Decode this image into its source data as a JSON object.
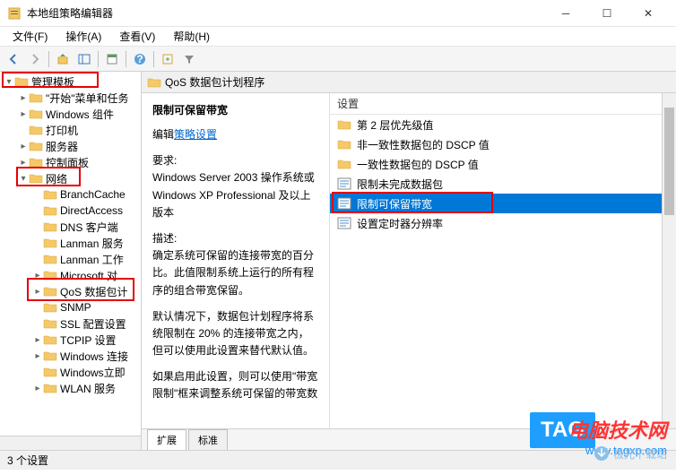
{
  "window": {
    "title": "本地组策略编辑器"
  },
  "menu": {
    "file": "文件(F)",
    "action": "操作(A)",
    "view": "查看(V)",
    "help": "帮助(H)"
  },
  "tree": {
    "items": [
      {
        "label": "管理模板",
        "indent": 0,
        "arrow": "▾"
      },
      {
        "label": "\"开始\"菜单和任务",
        "indent": 1,
        "arrow": "▸"
      },
      {
        "label": "Windows 组件",
        "indent": 1,
        "arrow": "▸"
      },
      {
        "label": "打印机",
        "indent": 1,
        "arrow": ""
      },
      {
        "label": "服务器",
        "indent": 1,
        "arrow": "▸"
      },
      {
        "label": "控制面板",
        "indent": 1,
        "arrow": "▸"
      },
      {
        "label": "网络",
        "indent": 1,
        "arrow": "▾"
      },
      {
        "label": "BranchCache",
        "indent": 2,
        "arrow": ""
      },
      {
        "label": "DirectAccess",
        "indent": 2,
        "arrow": ""
      },
      {
        "label": "DNS 客户端",
        "indent": 2,
        "arrow": ""
      },
      {
        "label": "Lanman 服务",
        "indent": 2,
        "arrow": ""
      },
      {
        "label": "Lanman 工作",
        "indent": 2,
        "arrow": ""
      },
      {
        "label": "Microsoft 对",
        "indent": 2,
        "arrow": "▸"
      },
      {
        "label": "QoS 数据包计",
        "indent": 2,
        "arrow": "▸"
      },
      {
        "label": "SNMP",
        "indent": 2,
        "arrow": ""
      },
      {
        "label": "SSL 配置设置",
        "indent": 2,
        "arrow": ""
      },
      {
        "label": "TCPIP 设置",
        "indent": 2,
        "arrow": "▸"
      },
      {
        "label": "Windows 连接",
        "indent": 2,
        "arrow": "▸"
      },
      {
        "label": "Windows立即",
        "indent": 2,
        "arrow": ""
      },
      {
        "label": "WLAN 服务",
        "indent": 2,
        "arrow": "▸"
      }
    ]
  },
  "content": {
    "header": "QoS 数据包计划程序",
    "title": "限制可保留带宽",
    "edit_prefix": "编辑",
    "edit_link": "策略设置",
    "req_label": "要求:",
    "req_text": "Windows Server 2003 操作系统或 Windows XP Professional 及以上版本",
    "desc_label": "描述:",
    "desc_text1": "确定系统可保留的连接带宽的百分比。此值限制系统上运行的所有程序的组合带宽保留。",
    "desc_text2": "默认情况下，数据包计划程序将系统限制在 20% 的连接带宽之内，但可以使用此设置来替代默认值。",
    "desc_text3": "如果启用此设置，则可以使用\"带宽限制\"框来调整系统可保留的带宽数"
  },
  "right": {
    "header": "设置",
    "items": [
      {
        "label": "第 2 层优先级值",
        "type": "folder"
      },
      {
        "label": "非一致性数据包的 DSCP 值",
        "type": "folder"
      },
      {
        "label": "一致性数据包的 DSCP 值",
        "type": "folder"
      },
      {
        "label": "限制未完成数据包",
        "type": "setting"
      },
      {
        "label": "限制可保留带宽",
        "type": "setting",
        "selected": true
      },
      {
        "label": "设置定时器分辨率",
        "type": "setting"
      }
    ]
  },
  "tabs": {
    "extended": "扩展",
    "standard": "标准"
  },
  "status": "3 个设置",
  "watermark": {
    "line1": "电脑技术网",
    "line2": "www.tagxp.com",
    "tag": "TAG",
    "jg": "极光下载站"
  }
}
